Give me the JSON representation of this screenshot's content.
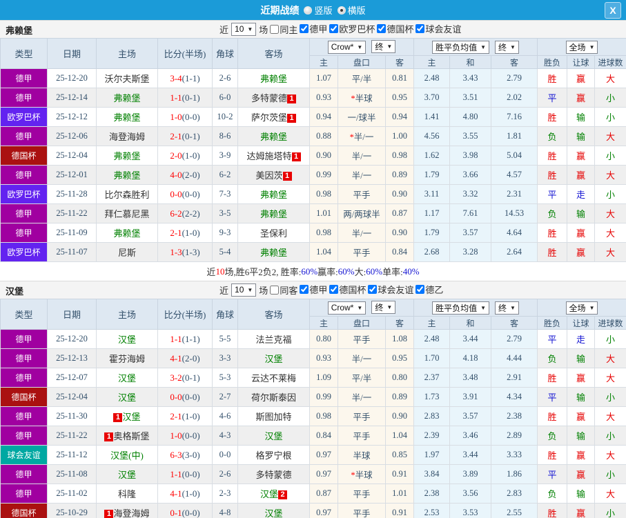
{
  "titlebar": {
    "title": "近期战绩",
    "vertical_label": "竖版",
    "horizontal_label": "横版",
    "close_glyph": "X"
  },
  "columns": {
    "type": "类型",
    "date": "日期",
    "home": "主场",
    "score": "比分(半场)",
    "corner": "角球",
    "away": "客场",
    "crow_select": "Crow*",
    "final_select": "终",
    "avg_select": "胜平负均值",
    "final_select2": "终",
    "scope_select": "全场",
    "sub": {
      "home": "主",
      "handicap": "盘口",
      "away": "客",
      "avg_home": "主",
      "avg_draw": "和",
      "avg_away": "客",
      "result": "胜负",
      "let": "让球",
      "goals": "进球数"
    }
  },
  "colors": {
    "titlebar_bg": "#1B9BD8",
    "type_colors": {
      "德甲": "#A000A0",
      "欧罗巴杯": "#6323F0",
      "德国杯": "#AA1111",
      "球会友谊": "#00A8A2"
    },
    "result_colors": {
      "red": "#E60000",
      "blue": "#1414D2",
      "green": "#008000"
    },
    "green_team": "#008000",
    "score_red": "#FF0000"
  },
  "sections": [
    {
      "team": "弗赖堡",
      "filter": {
        "near_label": "近",
        "count": "10",
        "games_label": "场",
        "same_label": "同主",
        "same_checked": false,
        "leagues": [
          {
            "label": "德甲",
            "checked": true
          },
          {
            "label": "欧罗巴杯",
            "checked": true
          },
          {
            "label": "德国杯",
            "checked": true
          },
          {
            "label": "球会友谊",
            "checked": true
          }
        ]
      },
      "rows": [
        {
          "type": "德甲",
          "date": "25-12-20",
          "home": "沃尔夫斯堡",
          "home_green": false,
          "home_badge": "",
          "score": "3-4",
          "half": "(1-1)",
          "corner": "2-6",
          "away": "弗赖堡",
          "away_green": true,
          "away_badge": "",
          "crow_home": "1.07",
          "star": false,
          "handicap": "平/半",
          "crow_away": "0.81",
          "avg_home": "2.48",
          "avg_draw": "3.43",
          "avg_away": "2.79",
          "result": "胜",
          "result_color": "red",
          "handicap_result": "赢",
          "handicap_color": "red",
          "goals": "大",
          "goals_color": "red"
        },
        {
          "type": "德甲",
          "date": "25-12-14",
          "home": "弗赖堡",
          "home_green": true,
          "home_badge": "",
          "score": "1-1",
          "half": "(0-1)",
          "corner": "6-0",
          "away": "多特蒙德",
          "away_green": false,
          "away_badge": "1",
          "crow_home": "0.93",
          "star": true,
          "handicap": "半球",
          "crow_away": "0.95",
          "avg_home": "3.70",
          "avg_draw": "3.51",
          "avg_away": "2.02",
          "result": "平",
          "result_color": "blue",
          "handicap_result": "赢",
          "handicap_color": "red",
          "goals": "小",
          "goals_color": "green"
        },
        {
          "type": "欧罗巴杯",
          "date": "25-12-12",
          "home": "弗赖堡",
          "home_green": true,
          "home_badge": "",
          "score": "1-0",
          "half": "(0-0)",
          "corner": "10-2",
          "away": "萨尔茨堡",
          "away_green": false,
          "away_badge": "1",
          "crow_home": "0.94",
          "star": false,
          "handicap": "一/球半",
          "crow_away": "0.94",
          "avg_home": "1.41",
          "avg_draw": "4.80",
          "avg_away": "7.16",
          "result": "胜",
          "result_color": "red",
          "handicap_result": "输",
          "handicap_color": "green",
          "goals": "小",
          "goals_color": "green"
        },
        {
          "type": "德甲",
          "date": "25-12-06",
          "home": "海登海姆",
          "home_green": false,
          "home_badge": "",
          "score": "2-1",
          "half": "(0-1)",
          "corner": "8-6",
          "away": "弗赖堡",
          "away_green": true,
          "away_badge": "",
          "crow_home": "0.88",
          "star": true,
          "handicap": "半/一",
          "crow_away": "1.00",
          "avg_home": "4.56",
          "avg_draw": "3.55",
          "avg_away": "1.81",
          "result": "负",
          "result_color": "green",
          "handicap_result": "输",
          "handicap_color": "green",
          "goals": "大",
          "goals_color": "red"
        },
        {
          "type": "德国杯",
          "date": "25-12-04",
          "home": "弗赖堡",
          "home_green": true,
          "home_badge": "",
          "score": "2-0",
          "half": "(1-0)",
          "corner": "3-9",
          "away": "达姆施塔特",
          "away_green": false,
          "away_badge": "1",
          "crow_home": "0.90",
          "star": false,
          "handicap": "半/一",
          "crow_away": "0.98",
          "avg_home": "1.62",
          "avg_draw": "3.98",
          "avg_away": "5.04",
          "result": "胜",
          "result_color": "red",
          "handicap_result": "赢",
          "handicap_color": "red",
          "goals": "小",
          "goals_color": "green"
        },
        {
          "type": "德甲",
          "date": "25-12-01",
          "home": "弗赖堡",
          "home_green": true,
          "home_badge": "",
          "score": "4-0",
          "half": "(2-0)",
          "corner": "6-2",
          "away": "美因茨",
          "away_green": false,
          "away_badge": "1",
          "crow_home": "0.99",
          "star": false,
          "handicap": "半/一",
          "crow_away": "0.89",
          "avg_home": "1.79",
          "avg_draw": "3.66",
          "avg_away": "4.57",
          "result": "胜",
          "result_color": "red",
          "handicap_result": "赢",
          "handicap_color": "red",
          "goals": "大",
          "goals_color": "red"
        },
        {
          "type": "欧罗巴杯",
          "date": "25-11-28",
          "home": "比尔森胜利",
          "home_green": false,
          "home_badge": "",
          "score": "0-0",
          "half": "(0-0)",
          "corner": "7-3",
          "away": "弗赖堡",
          "away_green": true,
          "away_badge": "",
          "crow_home": "0.98",
          "star": false,
          "handicap": "平手",
          "crow_away": "0.90",
          "avg_home": "3.11",
          "avg_draw": "3.32",
          "avg_away": "2.31",
          "result": "平",
          "result_color": "blue",
          "handicap_result": "走",
          "handicap_color": "blue",
          "goals": "小",
          "goals_color": "green"
        },
        {
          "type": "德甲",
          "date": "25-11-22",
          "home": "拜仁慕尼黑",
          "home_green": false,
          "home_badge": "",
          "score": "6-2",
          "half": "(2-2)",
          "corner": "3-5",
          "away": "弗赖堡",
          "away_green": true,
          "away_badge": "",
          "crow_home": "1.01",
          "star": false,
          "handicap": "两/两球半",
          "crow_away": "0.87",
          "avg_home": "1.17",
          "avg_draw": "7.61",
          "avg_away": "14.53",
          "result": "负",
          "result_color": "green",
          "handicap_result": "输",
          "handicap_color": "green",
          "goals": "大",
          "goals_color": "red"
        },
        {
          "type": "德甲",
          "date": "25-11-09",
          "home": "弗赖堡",
          "home_green": true,
          "home_badge": "",
          "score": "2-1",
          "half": "(1-0)",
          "corner": "9-3",
          "away": "圣保利",
          "away_green": false,
          "away_badge": "",
          "crow_home": "0.98",
          "star": false,
          "handicap": "半/一",
          "crow_away": "0.90",
          "avg_home": "1.79",
          "avg_draw": "3.57",
          "avg_away": "4.64",
          "result": "胜",
          "result_color": "red",
          "handicap_result": "赢",
          "handicap_color": "red",
          "goals": "大",
          "goals_color": "red"
        },
        {
          "type": "欧罗巴杯",
          "date": "25-11-07",
          "home": "尼斯",
          "home_green": false,
          "home_badge": "",
          "score": "1-3",
          "half": "(1-3)",
          "corner": "5-4",
          "away": "弗赖堡",
          "away_green": true,
          "away_badge": "",
          "crow_home": "1.04",
          "star": false,
          "handicap": "平手",
          "crow_away": "0.84",
          "avg_home": "2.68",
          "avg_draw": "3.28",
          "avg_away": "2.64",
          "result": "胜",
          "result_color": "red",
          "handicap_result": "赢",
          "handicap_color": "red",
          "goals": "大",
          "goals_color": "red"
        }
      ],
      "summary": {
        "parts": [
          {
            "text": "近",
            "color": "dark"
          },
          {
            "text": "10",
            "color": "red"
          },
          {
            "text": "场,胜6平2负2, 胜率:",
            "color": "dark"
          },
          {
            "text": "60%",
            "color": "blue"
          },
          {
            "text": " 赢率:",
            "color": "dark"
          },
          {
            "text": "60%",
            "color": "blue"
          },
          {
            "text": " 大:",
            "color": "dark"
          },
          {
            "text": "60%",
            "color": "blue"
          },
          {
            "text": " 单率:",
            "color": "dark"
          },
          {
            "text": "40%",
            "color": "blue"
          }
        ]
      }
    },
    {
      "team": "汉堡",
      "filter": {
        "near_label": "近",
        "count": "10",
        "games_label": "场",
        "same_label": "同客",
        "same_checked": false,
        "leagues": [
          {
            "label": "德甲",
            "checked": true
          },
          {
            "label": "德国杯",
            "checked": true
          },
          {
            "label": "球会友谊",
            "checked": true
          },
          {
            "label": "德乙",
            "checked": true
          }
        ]
      },
      "rows": [
        {
          "type": "德甲",
          "date": "25-12-20",
          "home": "汉堡",
          "home_green": true,
          "home_badge": "",
          "score": "1-1",
          "half": "(1-1)",
          "corner": "5-5",
          "away": "法兰克福",
          "away_green": false,
          "away_badge": "",
          "crow_home": "0.80",
          "star": false,
          "handicap": "平手",
          "crow_away": "1.08",
          "avg_home": "2.48",
          "avg_draw": "3.44",
          "avg_away": "2.79",
          "result": "平",
          "result_color": "blue",
          "handicap_result": "走",
          "handicap_color": "blue",
          "goals": "小",
          "goals_color": "green"
        },
        {
          "type": "德甲",
          "date": "25-12-13",
          "home": "霍芬海姆",
          "home_green": false,
          "home_badge": "",
          "score": "4-1",
          "half": "(2-0)",
          "corner": "3-3",
          "away": "汉堡",
          "away_green": true,
          "away_badge": "",
          "crow_home": "0.93",
          "star": false,
          "handicap": "半/一",
          "crow_away": "0.95",
          "avg_home": "1.70",
          "avg_draw": "4.18",
          "avg_away": "4.44",
          "result": "负",
          "result_color": "green",
          "handicap_result": "输",
          "handicap_color": "green",
          "goals": "大",
          "goals_color": "red"
        },
        {
          "type": "德甲",
          "date": "25-12-07",
          "home": "汉堡",
          "home_green": true,
          "home_badge": "",
          "score": "3-2",
          "half": "(0-1)",
          "corner": "5-3",
          "away": "云达不莱梅",
          "away_green": false,
          "away_badge": "",
          "crow_home": "1.09",
          "star": false,
          "handicap": "平/半",
          "crow_away": "0.80",
          "avg_home": "2.37",
          "avg_draw": "3.48",
          "avg_away": "2.91",
          "result": "胜",
          "result_color": "red",
          "handicap_result": "赢",
          "handicap_color": "red",
          "goals": "大",
          "goals_color": "red"
        },
        {
          "type": "德国杯",
          "date": "25-12-04",
          "home": "汉堡",
          "home_green": true,
          "home_badge": "",
          "score": "0-0",
          "half": "(0-0)",
          "corner": "2-7",
          "away": "荷尔斯泰因",
          "away_green": false,
          "away_badge": "",
          "crow_home": "0.99",
          "star": false,
          "handicap": "半/一",
          "crow_away": "0.89",
          "avg_home": "1.73",
          "avg_draw": "3.91",
          "avg_away": "4.34",
          "result": "平",
          "result_color": "blue",
          "handicap_result": "输",
          "handicap_color": "green",
          "goals": "小",
          "goals_color": "green"
        },
        {
          "type": "德甲",
          "date": "25-11-30",
          "home": "汉堡",
          "home_green": true,
          "home_badge": "1",
          "score": "2-1",
          "half": "(1-0)",
          "corner": "4-6",
          "away": "斯图加特",
          "away_green": false,
          "away_badge": "",
          "crow_home": "0.98",
          "star": false,
          "handicap": "平手",
          "crow_away": "0.90",
          "avg_home": "2.83",
          "avg_draw": "3.57",
          "avg_away": "2.38",
          "result": "胜",
          "result_color": "red",
          "handicap_result": "赢",
          "handicap_color": "red",
          "goals": "大",
          "goals_color": "red"
        },
        {
          "type": "德甲",
          "date": "25-11-22",
          "home": "奥格斯堡",
          "home_green": false,
          "home_badge": "1",
          "score": "1-0",
          "half": "(0-0)",
          "corner": "4-3",
          "away": "汉堡",
          "away_green": true,
          "away_badge": "",
          "crow_home": "0.84",
          "star": false,
          "handicap": "平手",
          "crow_away": "1.04",
          "avg_home": "2.39",
          "avg_draw": "3.46",
          "avg_away": "2.89",
          "result": "负",
          "result_color": "green",
          "handicap_result": "输",
          "handicap_color": "green",
          "goals": "小",
          "goals_color": "green"
        },
        {
          "type": "球会友谊",
          "date": "25-11-12",
          "home": "汉堡(中)",
          "home_green": true,
          "home_badge": "",
          "score": "6-3",
          "half": "(3-0)",
          "corner": "0-0",
          "away": "格罗宁根",
          "away_green": false,
          "away_badge": "",
          "crow_home": "0.97",
          "star": false,
          "handicap": "半球",
          "crow_away": "0.85",
          "avg_home": "1.97",
          "avg_draw": "3.44",
          "avg_away": "3.33",
          "result": "胜",
          "result_color": "red",
          "handicap_result": "赢",
          "handicap_color": "red",
          "goals": "大",
          "goals_color": "red"
        },
        {
          "type": "德甲",
          "date": "25-11-08",
          "home": "汉堡",
          "home_green": true,
          "home_badge": "",
          "score": "1-1",
          "half": "(0-0)",
          "corner": "2-6",
          "away": "多特蒙德",
          "away_green": false,
          "away_badge": "",
          "crow_home": "0.97",
          "star": true,
          "handicap": "半球",
          "crow_away": "0.91",
          "avg_home": "3.84",
          "avg_draw": "3.89",
          "avg_away": "1.86",
          "result": "平",
          "result_color": "blue",
          "handicap_result": "赢",
          "handicap_color": "red",
          "goals": "小",
          "goals_color": "green"
        },
        {
          "type": "德甲",
          "date": "25-11-02",
          "home": "科隆",
          "home_green": false,
          "home_badge": "",
          "score": "4-1",
          "half": "(1-0)",
          "corner": "2-3",
          "away": "汉堡",
          "away_green": true,
          "away_badge": "2",
          "crow_home": "0.87",
          "star": false,
          "handicap": "平手",
          "crow_away": "1.01",
          "avg_home": "2.38",
          "avg_draw": "3.56",
          "avg_away": "2.83",
          "result": "负",
          "result_color": "green",
          "handicap_result": "输",
          "handicap_color": "green",
          "goals": "大",
          "goals_color": "red"
        },
        {
          "type": "德国杯",
          "date": "25-10-29",
          "home": "海登海姆",
          "home_green": false,
          "home_badge": "1",
          "score": "0-1",
          "half": "(0-0)",
          "corner": "4-8",
          "away": "汉堡",
          "away_green": true,
          "away_badge": "",
          "crow_home": "0.97",
          "star": false,
          "handicap": "平手",
          "crow_away": "0.91",
          "avg_home": "2.53",
          "avg_draw": "3.53",
          "avg_away": "2.55",
          "result": "胜",
          "result_color": "red",
          "handicap_result": "赢",
          "handicap_color": "red",
          "goals": "小",
          "goals_color": "green"
        }
      ],
      "summary": null
    }
  ]
}
